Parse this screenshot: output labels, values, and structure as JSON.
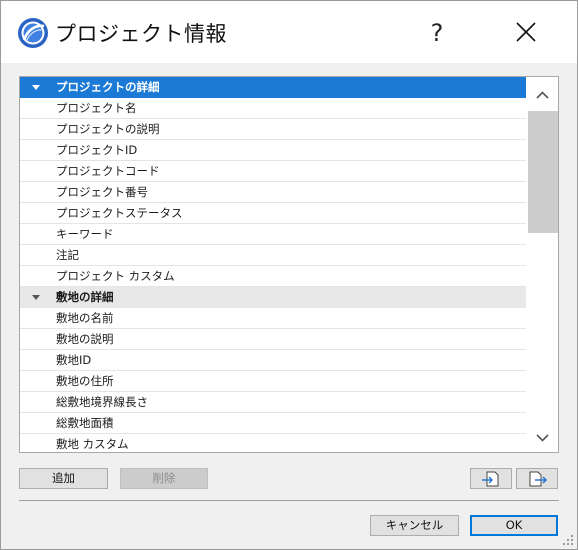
{
  "window": {
    "title": "プロジェクト情報",
    "help_label": "?"
  },
  "list": {
    "groups": [
      {
        "label": "プロジェクトの詳細",
        "expanded": true,
        "selected": true,
        "items": [
          "プロジェクト名",
          "プロジェクトの説明",
          "プロジェクトID",
          "プロジェクトコード",
          "プロジェクト番号",
          "プロジェクトステータス",
          "キーワード",
          "注記",
          "プロジェクト カスタム"
        ]
      },
      {
        "label": "敷地の詳細",
        "expanded": true,
        "selected": false,
        "items": [
          "敷地の名前",
          "敷地の説明",
          "敷地ID",
          "敷地の住所",
          "総敷地境界線長さ",
          "総敷地面積",
          "敷地 カスタム"
        ]
      }
    ]
  },
  "buttons": {
    "add": "追加",
    "delete": "削除",
    "cancel": "キャンセル",
    "ok": "OK"
  },
  "icons": {
    "app": "archicad-logo-icon",
    "import": "import-icon",
    "export": "export-icon"
  },
  "colors": {
    "selection": "#1a7ad6",
    "group_row": "#e8e8e8",
    "primary_border": "#0078d7"
  }
}
